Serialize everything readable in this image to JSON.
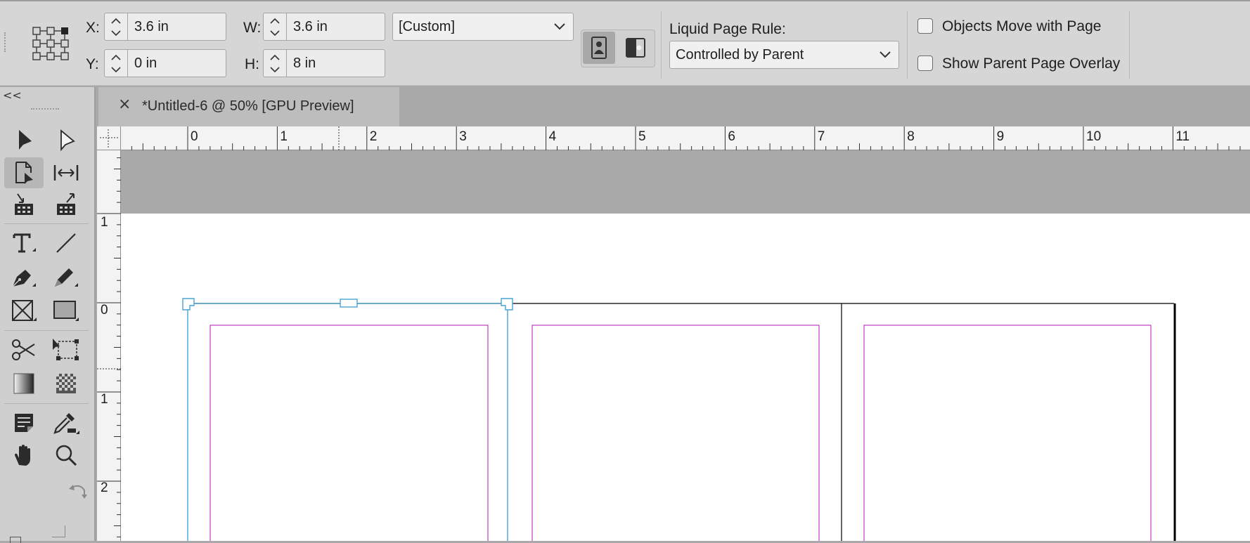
{
  "control_bar": {
    "x_label": "X:",
    "x_value": "3.6 in",
    "y_label": "Y:",
    "y_value": "0 in",
    "w_label": "W:",
    "w_value": "3.6 in",
    "h_label": "H:",
    "h_value": "8 in",
    "page_size_preset": "[Custom]",
    "liquid_page_rule_label": "Liquid Page Rule:",
    "liquid_page_rule_value": "Controlled by Parent",
    "objects_move_label": "Objects Move with Page",
    "objects_move_checked": false,
    "show_overlay_label": "Show Parent Page Overlay",
    "show_overlay_checked": false
  },
  "tools_panel": {
    "collapse_label": "<<",
    "tools": [
      "selection-tool",
      "direct-selection-tool",
      "page-tool",
      "gap-tool",
      "content-collector-tool",
      "content-placer-tool",
      "type-tool",
      "line-tool",
      "pen-tool",
      "pencil-tool",
      "rectangle-frame-tool",
      "rectangle-tool",
      "scissors-tool",
      "free-transform-tool",
      "gradient-swatch-tool",
      "gradient-feather-tool",
      "note-tool",
      "eyedropper-tool",
      "hand-tool",
      "zoom-tool"
    ]
  },
  "document_tab": {
    "close_label": "×",
    "title": "*Untitled-6 @ 50% [GPU Preview]"
  },
  "rulers": {
    "horizontal_labels": [
      "0",
      "1",
      "2",
      "3",
      "4",
      "5",
      "6",
      "7",
      "8",
      "9",
      "10",
      "11"
    ],
    "vertical_labels": [
      "1",
      "0",
      "1",
      "2"
    ]
  },
  "colors": {
    "selection_frame": "#4aa3d6",
    "margin_guides": "#c03ec0",
    "page_border": "#000000"
  }
}
